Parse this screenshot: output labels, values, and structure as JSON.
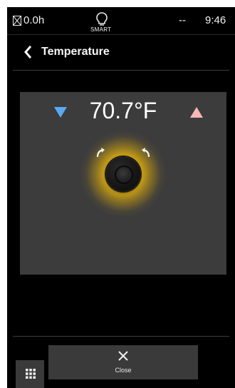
{
  "status_bar": {
    "hour_meter": "0.0h",
    "smart_label": "SMART",
    "signal": "--",
    "time": "9:46",
    "icons": [
      "hourglass-icon",
      "bulb-icon"
    ]
  },
  "header": {
    "title": "Temperature",
    "back_icon": "chevron-left-icon"
  },
  "temperature": {
    "value": "70.7°F",
    "down_icon": "triangle-down-icon",
    "up_icon": "triangle-up-icon",
    "knob_icon": "rotary-knob-icon"
  },
  "footer": {
    "close_label": "Close",
    "close_icon": "close-icon",
    "apps_icon": "grid-icon"
  },
  "colors": {
    "background": "#000000",
    "panel": "#3c3c3c",
    "down_arrow": "#5aa8f0",
    "up_arrow": "#f6b6b6",
    "knob_glow": "#ebbe14",
    "button": "#3a3a3a"
  }
}
